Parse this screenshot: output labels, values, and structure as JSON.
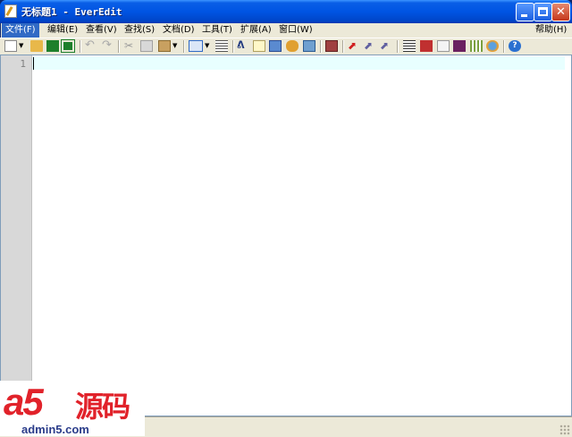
{
  "window": {
    "title": "无标题1 - EverEdit",
    "controls": [
      "minimize-icon",
      "maximize-icon",
      "close-icon"
    ]
  },
  "menu": {
    "items": [
      {
        "label": "文件(F)",
        "active": true
      },
      {
        "label": "编辑(E)"
      },
      {
        "label": "查看(V)"
      },
      {
        "label": "查找(S)"
      },
      {
        "label": "文档(D)"
      },
      {
        "label": "工具(T)"
      },
      {
        "label": "扩展(A)"
      },
      {
        "label": "窗口(W)"
      }
    ],
    "help": "帮助(H)"
  },
  "toolbar": {
    "icons": [
      "new-file-icon",
      "dropdown-arrow-icon",
      "open-folder-icon",
      "save-icon",
      "save-all-icon",
      "undo-icon",
      "redo-icon",
      "cut-icon",
      "copy-icon",
      "paste-icon",
      "paste-dropdown-icon",
      "view-mode-icon",
      "view-dropdown-icon",
      "outline-icon",
      "find-icon",
      "edit-note-icon",
      "replace-icon",
      "find-in-files-icon",
      "goto-icon",
      "hex-icon",
      "macro-record-icon",
      "macro-play-icon",
      "macro-step-icon",
      "indent-icon",
      "color-picker-icon",
      "document-icon",
      "console-icon",
      "calculator-icon",
      "browser-icon",
      "help-icon"
    ]
  },
  "editor": {
    "line_numbers": [
      "1"
    ],
    "content": ""
  },
  "watermark": {
    "brand": "a5",
    "brand_cn": "源码",
    "url": "admin5.com"
  },
  "colors": {
    "titlebar": "#0054e3",
    "menu_active": "#316ac5",
    "current_line": "#e8ffff",
    "gutter": "#d8d8d8",
    "brand_red": "#e1222a"
  }
}
